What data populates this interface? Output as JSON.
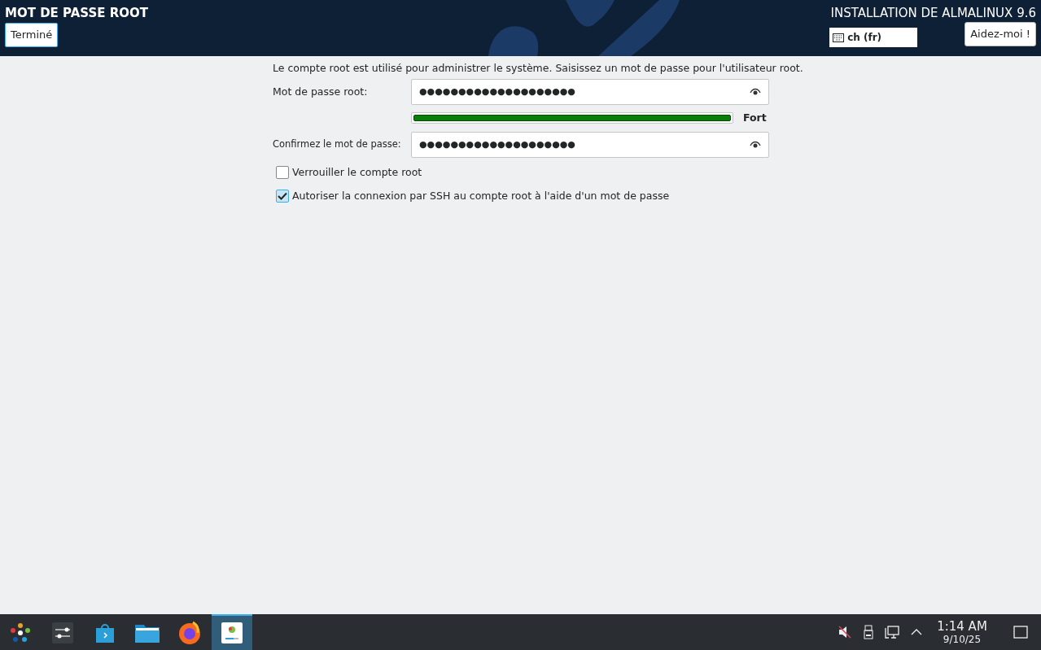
{
  "header": {
    "title": "MOT DE PASSE ROOT",
    "done_button": "Terminé",
    "product": "INSTALLATION DE ALMALINUX 9.6",
    "keyboard_layout": "ch (fr)",
    "help_button": "Aidez-moi !"
  },
  "intro": "Le compte root est utilisé pour administrer le système. Saisissez un mot de passe pour l'utilisateur root.",
  "password": {
    "label": "Mot de passe root:",
    "value": "●●●●●●●●●●●●●●●●●●●●"
  },
  "strength": {
    "level": 1,
    "reading": "Fort"
  },
  "confirm": {
    "label": "Confirmez le mot de passe:",
    "value": "●●●●●●●●●●●●●●●●●●●●"
  },
  "options": [
    {
      "label": "Verrouiller le compte root",
      "checked": false
    },
    {
      "label": "Autoriser la connexion par SSH au compte root à l'aide d'un mot de passe",
      "checked": true
    }
  ],
  "taskbar": {
    "apps": [
      {
        "kind": "launcher",
        "selected": false
      },
      {
        "kind": "settings",
        "selected": false
      },
      {
        "kind": "store",
        "selected": false
      },
      {
        "kind": "files",
        "selected": false
      },
      {
        "kind": "browser",
        "selected": false
      },
      {
        "kind": "installer",
        "selected": true
      }
    ],
    "time": "1:14 AM",
    "date": "9/10/25"
  }
}
